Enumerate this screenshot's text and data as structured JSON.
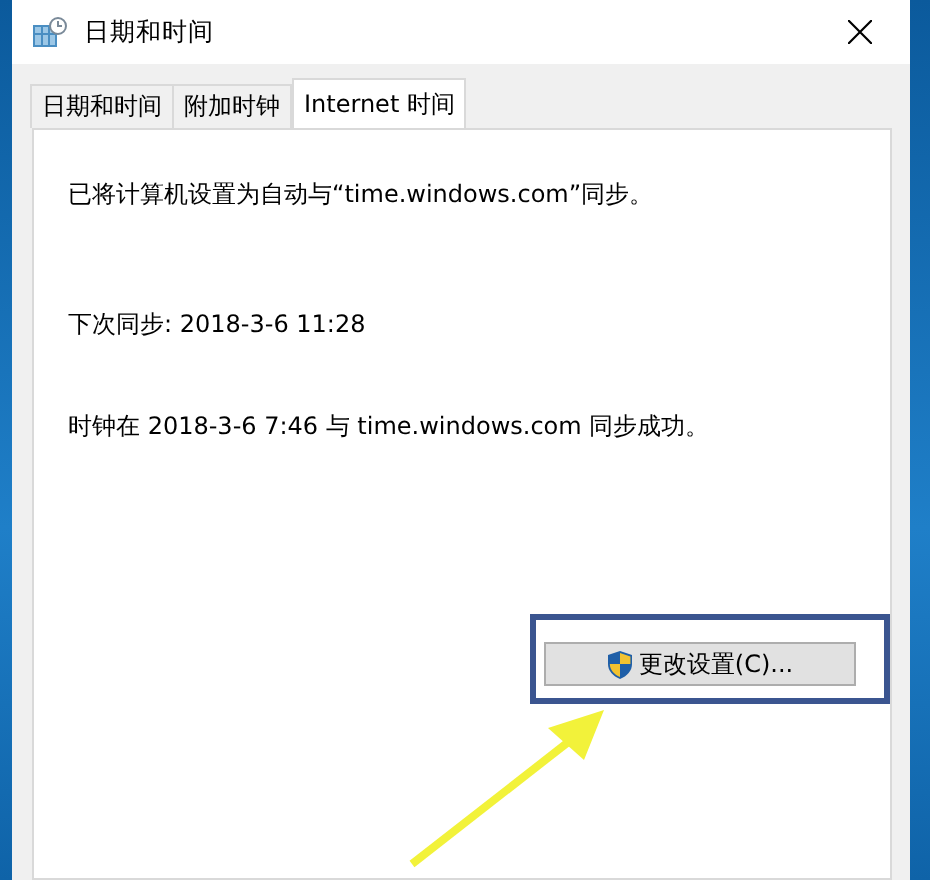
{
  "window": {
    "title": "日期和时间"
  },
  "tabs": [
    {
      "label": "日期和时间",
      "selected": false
    },
    {
      "label": "附加时钟",
      "selected": false
    },
    {
      "label": "Internet 时间",
      "selected": true
    }
  ],
  "messages": [
    "已将计算机设置为自动与“time.windows.com”同步。",
    "下次同步: 2018-3-6 11:28",
    "时钟在 2018-3-6 7:46 与 time.windows.com 同步成功。"
  ],
  "button": {
    "label": "更改设置(C)..."
  }
}
